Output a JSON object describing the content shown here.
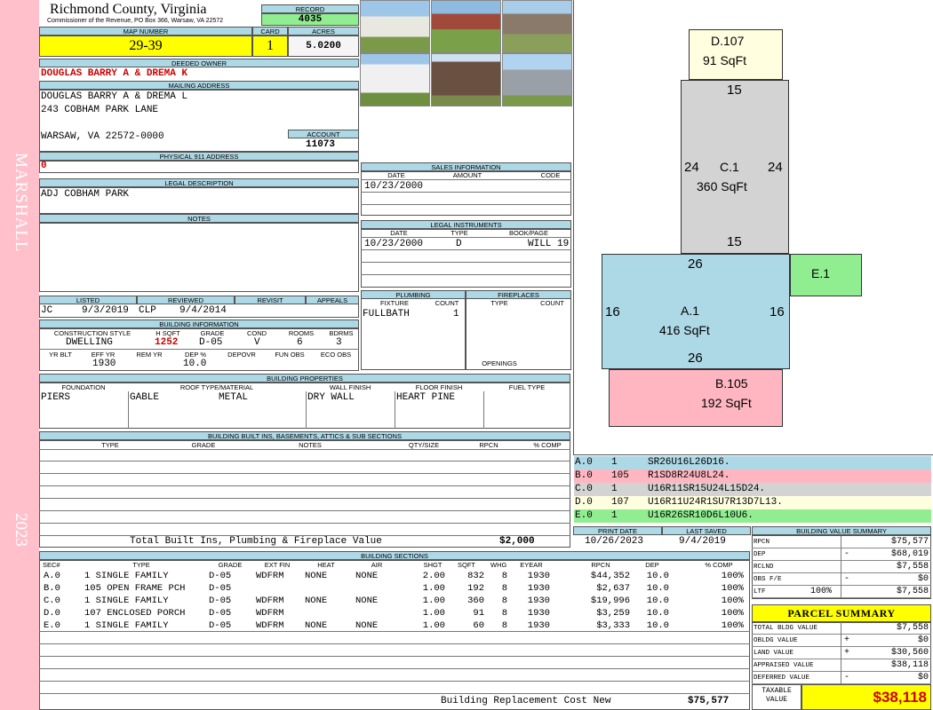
{
  "sidebar": {
    "top_text": "MARSHALL",
    "bottom_text": "2023"
  },
  "header": {
    "county": "Richmond County, Virginia",
    "commissioner": "Commissioner of the Revenue, PO Box 366, Warsaw, VA 22572",
    "record_label": "RECORD",
    "record": "4035",
    "map_label": "MAP NUMBER",
    "map": "29-39",
    "card_label": "CARD",
    "card": "1",
    "acres_label": "ACRES",
    "acres": "5.0200"
  },
  "owner": {
    "deeded_label": "DEEDED OWNER",
    "deeded": "DOUGLAS BARRY A & DREMA K",
    "mailing_label": "MAILING ADDRESS",
    "mail_line1": "DOUGLAS BARRY A & DREMA L",
    "mail_line2": "243 COBHAM PARK LANE",
    "mail_line3": "WARSAW, VA 22572-0000",
    "account_label": "ACCOUNT",
    "account": "11073",
    "physical_label": "PHYSICAL 911 ADDRESS",
    "physical": "0"
  },
  "legal": {
    "label": "LEGAL DESCRIPTION",
    "text": "ADJ COBHAM PARK",
    "notes_label": "NOTES"
  },
  "sales": {
    "label": "SALES INFORMATION",
    "date_label": "DATE",
    "amount_label": "AMOUNT",
    "code_label": "CODE",
    "date": "10/23/2000"
  },
  "instruments": {
    "label": "LEGAL INSTRUMENTS",
    "date_label": "DATE",
    "type_label": "TYPE",
    "book_label": "BOOK/PAGE",
    "date": "10/23/2000",
    "type": "D",
    "book": "WILL 19"
  },
  "review": {
    "listed_label": "LISTED",
    "listed_by": "JC",
    "listed_date": "9/3/2019",
    "reviewed_label": "REVIEWED",
    "reviewed_by": "CLP",
    "reviewed_date": "9/4/2014",
    "revisit_label": "REVISIT",
    "appeals_label": "APPEALS"
  },
  "building_info": {
    "label": "BUILDING INFORMATION",
    "style_label": "CONSTRUCTION STYLE",
    "style": "DWELLING",
    "hsqft_label": "H SQFT",
    "hsqft": "1252",
    "grade_label": "GRADE",
    "grade": "D-05",
    "cond_label": "COND",
    "cond": "V",
    "rooms_label": "ROOMS",
    "rooms": "6",
    "bdrms_label": "BDRMS",
    "bdrms": "3",
    "yrblt_label": "YR BLT",
    "effyr_label": "EFF YR",
    "effyr": "1930",
    "remyr_label": "REM YR",
    "dep_label": "DEP %",
    "dep": "10.0",
    "depovr_label": "DEPOVR",
    "funobs_label": "FUN OBS",
    "ecoobs_label": "ECO OBS"
  },
  "plumbing": {
    "label": "PLUMBING",
    "fixture_label": "FIXTURE",
    "count_label": "COUNT",
    "fixture": "FULLBATH",
    "count": "1"
  },
  "fireplaces": {
    "label": "FIREPLACES",
    "type_label": "TYPE",
    "count_label": "COUNT",
    "openings_label": "OPENINGS"
  },
  "properties": {
    "label": "BUILDING PROPERTIES",
    "foundation_label": "FOUNDATION",
    "foundation": "PIERS",
    "roof_label": "ROOF TYPE/MATERIAL",
    "roof_type": "GABLE",
    "roof_mat": "METAL",
    "wall_label": "WALL FINISH",
    "wall": "DRY WALL",
    "floor_label": "FLOOR FINISH",
    "floor": "HEART PINE",
    "fuel_label": "FUEL TYPE"
  },
  "builtins": {
    "label": "BUILDING BUILT INS, BASEMENTS, ATTICS & SUB SECTIONS",
    "type_label": "TYPE",
    "grade_label": "GRADE",
    "notes_label": "NOTES",
    "qty_label": "QTY/SIZE",
    "rpcn_label": "RPCN",
    "comp_label": "% COMP",
    "total_label": "Total Built Ins, Plumbing & Fireplace Value",
    "total": "$2,000"
  },
  "dates": {
    "print_label": "PRINT DATE",
    "print": "10/26/2023",
    "saved_label": "LAST SAVED",
    "saved": "9/4/2019"
  },
  "sections": {
    "label": "BUILDING SECTIONS",
    "headers": [
      "SEC#",
      "TYPE",
      "GRADE",
      "EXT FIN",
      "HEAT",
      "AIR",
      "SHGT",
      "SQFT",
      "WHGT",
      "EYEAR",
      "RPCN",
      "DEP",
      "% COMP"
    ],
    "rows": [
      [
        "A.0",
        "1 SINGLE FAMILY",
        "D-05",
        "WDFRM",
        "NONE",
        "NONE",
        "2.00",
        "832",
        "8",
        "1930",
        "$44,352",
        "10.0",
        "100%"
      ],
      [
        "B.0",
        "105 OPEN FRAME PCH",
        "D-05",
        "",
        "",
        "",
        "1.00",
        "192",
        "8",
        "1930",
        "$2,637",
        "10.0",
        "100%"
      ],
      [
        "C.0",
        "1 SINGLE FAMILY",
        "D-05",
        "WDFRM",
        "NONE",
        "NONE",
        "1.00",
        "360",
        "8",
        "1930",
        "$19,996",
        "10.0",
        "100%"
      ],
      [
        "D.0",
        "107 ENCLOSED PORCH",
        "D-05",
        "WDFRM",
        "",
        "",
        "1.00",
        "91",
        "8",
        "1930",
        "$3,259",
        "10.0",
        "100%"
      ],
      [
        "E.0",
        "1 SINGLE FAMILY",
        "D-05",
        "WDFRM",
        "NONE",
        "NONE",
        "1.00",
        "60",
        "8",
        "1930",
        "$3,333",
        "10.0",
        "100%"
      ]
    ],
    "total_label": "Building Replacement Cost New",
    "total": "$75,577"
  },
  "value_summary": {
    "label": "BUILDING VALUE SUMMARY",
    "rows": [
      {
        "k": "RPCN",
        "sign": "",
        "pct": "",
        "v": "$75,577"
      },
      {
        "k": "DEP",
        "sign": "-",
        "pct": "",
        "v": "$68,019"
      },
      {
        "k": "RCLND",
        "sign": "",
        "pct": "",
        "v": "$7,558"
      },
      {
        "k": "OBS F/E",
        "sign": "-",
        "pct": "",
        "v": "$0"
      },
      {
        "k": "LTF",
        "sign": "",
        "pct": "100%",
        "v": "$7,558"
      }
    ]
  },
  "parcel": {
    "label": "PARCEL SUMMARY",
    "rows": [
      {
        "k": "TOTAL BLDG VALUE",
        "sign": "",
        "v": "$7,558"
      },
      {
        "k": "OBLDG VALUE",
        "sign": "+",
        "v": "$0"
      },
      {
        "k": "LAND VALUE",
        "sign": "+",
        "v": "$30,560"
      },
      {
        "k": "APPRAISED VALUE",
        "sign": "",
        "v": "$38,118"
      },
      {
        "k": "DEFERRED VALUE",
        "sign": "-",
        "v": "$0"
      }
    ],
    "taxable_label1": "TAXABLE",
    "taxable_label2": "VALUE",
    "taxable": "$38,118"
  },
  "sketch": {
    "D": {
      "label": "D.107",
      "area": "91 SqFt"
    },
    "C": {
      "label": "C.1",
      "area": "360 SqFt",
      "top": "15",
      "left": "24",
      "right": "24",
      "bottom": "15"
    },
    "A": {
      "label": "A.1",
      "area": "416 SqFt",
      "top": "26",
      "left": "16",
      "right": "16",
      "bottom": "26"
    },
    "E": {
      "label": "E.1"
    },
    "B": {
      "label": "B.105",
      "area": "192 SqFt"
    }
  },
  "codes": [
    {
      "sec": "A.0",
      "n": "1",
      "code": "SR26U16L26D16.",
      "color": "#add8e6"
    },
    {
      "sec": "B.0",
      "n": "105",
      "code": "R1SD8R24U8L24.",
      "color": "#ffb6c1"
    },
    {
      "sec": "C.0",
      "n": "1",
      "code": "U16R11SR15U24L15D24.",
      "color": "#d3d3d3"
    },
    {
      "sec": "D.0",
      "n": "107",
      "code": "U16R11U24R1SU7R13D7L13.",
      "color": "#ffffe0"
    },
    {
      "sec": "E.0",
      "n": "1",
      "code": "U16R26SR10D6L10U6.",
      "color": "#90ee90"
    }
  ]
}
